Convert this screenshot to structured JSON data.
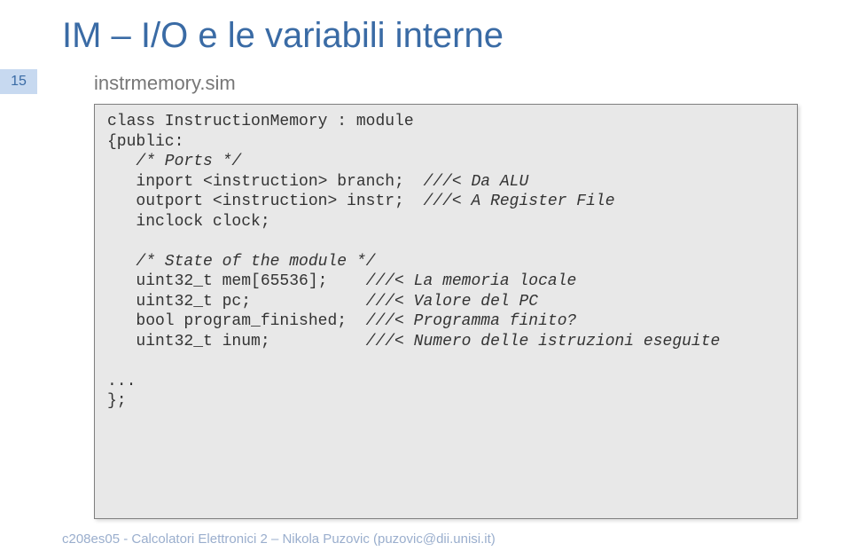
{
  "title": "IM – I/O e le variabili interne",
  "page_number": "15",
  "subtitle": "instrmemory.sim",
  "code": {
    "line1": "class InstructionMemory : module",
    "line2": "{public:",
    "line3": "   /* Ports */",
    "line4a": "   inport <instruction> branch;  ",
    "line4b": "///< Da ALU",
    "line5a": "   outport <instruction> instr;  ",
    "line5b": "///< A Register File",
    "line6": "   inclock clock;",
    "line7": "",
    "line8": "   /* State of the module */",
    "line9a": "   uint32_t mem[65536];    ",
    "line9b": "///< La memoria locale",
    "line10a": "   uint32_t pc;            ",
    "line10b": "///< Valore del PC",
    "line11a": "   bool program_finished;  ",
    "line11b": "///< Programma finito?",
    "line12a": "   uint32_t inum;          ",
    "line12b": "///< Numero delle istruzioni eseguite",
    "line13": "",
    "line14": "...",
    "line15": "};"
  },
  "footer": "c208es05 - Calcolatori Elettronici 2 – Nikola Puzovic (puzovic@dii.unisi.it)"
}
